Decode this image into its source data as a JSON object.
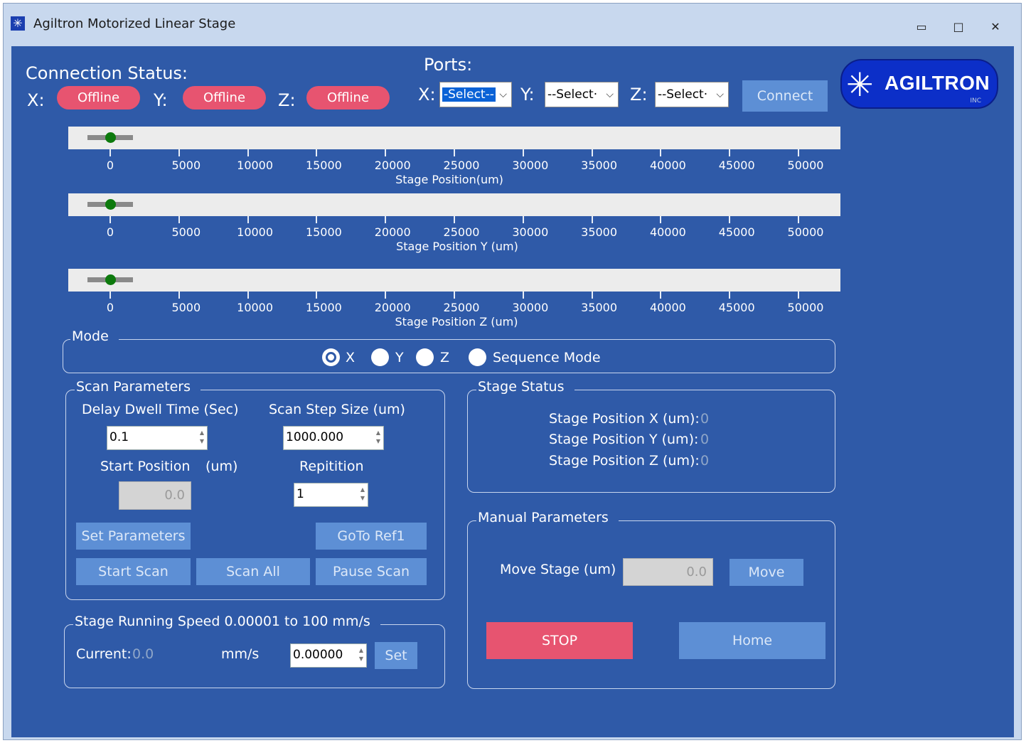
{
  "window": {
    "title": "Agiltron Motorized Linear Stage",
    "controls": {
      "minimize": "▭",
      "maximize": "□",
      "close": "✕"
    }
  },
  "connection": {
    "title": "Connection Status:",
    "x_label": "X:",
    "y_label": "Y:",
    "z_label": "Z:",
    "x_status": "Offline",
    "y_status": "Offline",
    "z_status": "Offline"
  },
  "ports": {
    "title": "Ports:",
    "x_label": "X:",
    "y_label": "Y:",
    "z_label": "Z:",
    "x_value": "-Select--",
    "y_value": "--Select·",
    "z_value": "--Select·",
    "connect_label": "Connect"
  },
  "logo": {
    "text": "AGILTRON",
    "inc": "INC"
  },
  "sliders": [
    {
      "axis_label": "Stage Position(um)",
      "position": 0
    },
    {
      "axis_label": "Stage Position Y (um)",
      "position": 0
    },
    {
      "axis_label": "Stage Position Z (um)",
      "position": 0
    }
  ],
  "ticks": [
    "0",
    "5000",
    "10000",
    "15000",
    "20000",
    "25000",
    "30000",
    "35000",
    "40000",
    "45000",
    "50000"
  ],
  "mode": {
    "title": "Mode",
    "options": [
      "X",
      "Y",
      "Z",
      "Sequence Mode"
    ],
    "selected": "X"
  },
  "scan": {
    "title": "Scan Parameters",
    "dwell_label": "Delay Dwell Time (Sec)",
    "dwell_value": "0.1",
    "step_label": "Scan Step Size (um)",
    "step_value": "1000.000",
    "start_label": "Start Position",
    "start_unit": "(um)",
    "start_value": "0.0",
    "rep_label": "Repitition",
    "rep_value": "1",
    "set_params": "Set Parameters",
    "goto_ref": "GoTo Ref1",
    "start_scan": "Start Scan",
    "scan_all": "Scan All",
    "pause_scan": "Pause Scan"
  },
  "speed": {
    "title": "Stage Running Speed 0.00001 to 100 mm/s",
    "current_label": "Current:",
    "current_value": "0.0",
    "unit": "mm/s",
    "speed_value": "0.00000",
    "set_label": "Set"
  },
  "status": {
    "title": "Stage Status",
    "x_label": "Stage Position X (um):",
    "y_label": "Stage Position Y (um):",
    "z_label": "Stage Position Z (um):",
    "x_value": "0",
    "y_value": "0",
    "z_value": "0"
  },
  "manual": {
    "title": "Manual Parameters",
    "move_label": "Move Stage (um)",
    "move_value": "0.0",
    "move_button": "Move",
    "stop_button": "STOP",
    "home_button": "Home"
  }
}
